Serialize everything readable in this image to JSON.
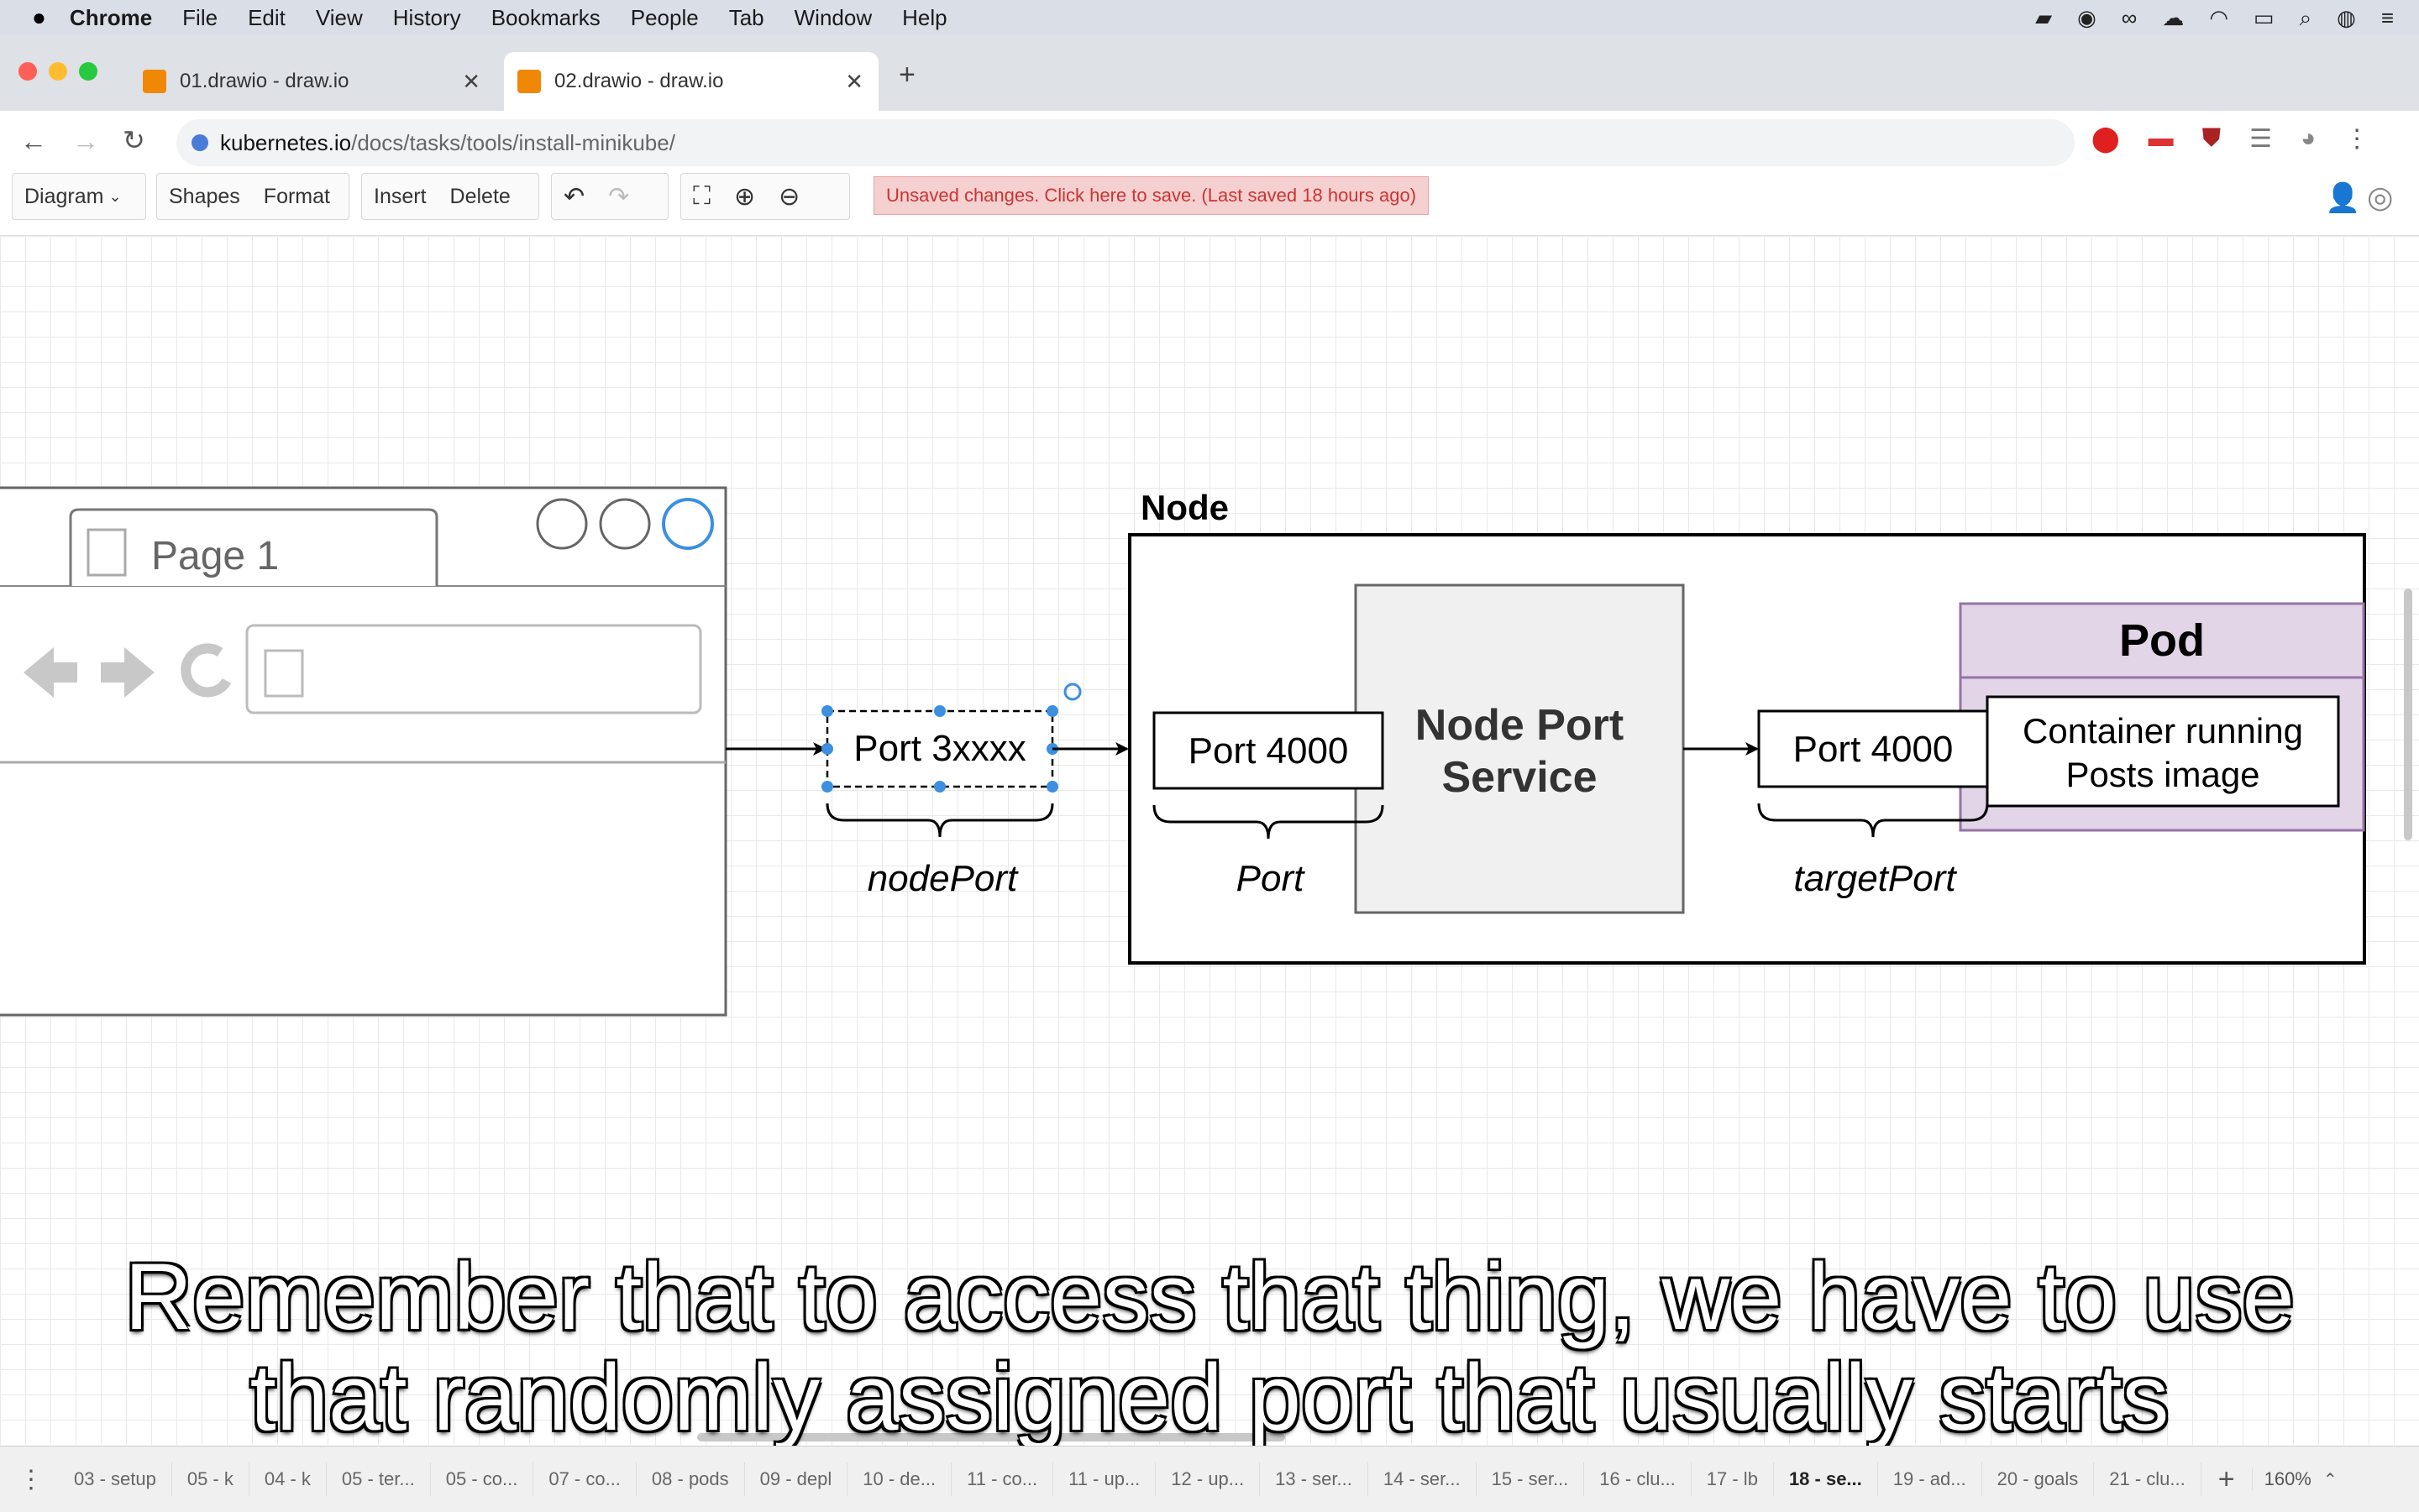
{
  "menubar": {
    "app": "Chrome",
    "items": [
      "File",
      "Edit",
      "View",
      "History",
      "Bookmarks",
      "People",
      "Tab",
      "Window",
      "Help"
    ]
  },
  "tabs": [
    {
      "title": "01.drawio - draw.io"
    },
    {
      "title": "02.drawio - draw.io"
    }
  ],
  "address": {
    "domain": "kubernetes.io",
    "path": "/docs/tasks/tools/install-minikube/"
  },
  "toolbar": {
    "diagram": "Diagram",
    "shapes": "Shapes",
    "format": "Format",
    "insert": "Insert",
    "delete": "Delete",
    "unsaved": "Unsaved changes. Click here to save. (Last saved 18 hours ago)"
  },
  "diagram": {
    "browser_tab": "Page 1",
    "node_label": "Node",
    "port_nodeport": "Port 3xxxx",
    "nodeport_label": "nodePort",
    "port_left": "Port 4000",
    "port_label": "Port",
    "service": "Node Port Service",
    "service_line1": "Node Port",
    "service_line2": "Service",
    "port_right": "Port 4000",
    "targetport_label": "targetPort",
    "pod": "Pod",
    "container_line1": "Container running",
    "container_line2": "Posts image"
  },
  "subtitle": {
    "line1": "Remember that to access that thing, we have to use",
    "line2": "that randomly assigned port that usually starts"
  },
  "page_tabs": [
    "03 - setup",
    "05 - k",
    "04 - k",
    "05 - ter...",
    "05 - co...",
    "07 - co...",
    "08 - pods",
    "09 - depl",
    "10 - de...",
    "11 - co...",
    "11 - up...",
    "12 - up...",
    "13 - ser...",
    "14 - ser...",
    "15 - ser...",
    "16 - clu...",
    "17 - lb",
    "18 - se...",
    "19 - ad...",
    "20 - goals",
    "21 - clu..."
  ],
  "zoom": "160%",
  "colors": {
    "pod_fill": "#e1d5e7",
    "pod_stroke": "#9673a6",
    "service_fill": "#f0f0f0",
    "selection": "#3d8fe0",
    "unsaved_text": "#cc3333"
  }
}
